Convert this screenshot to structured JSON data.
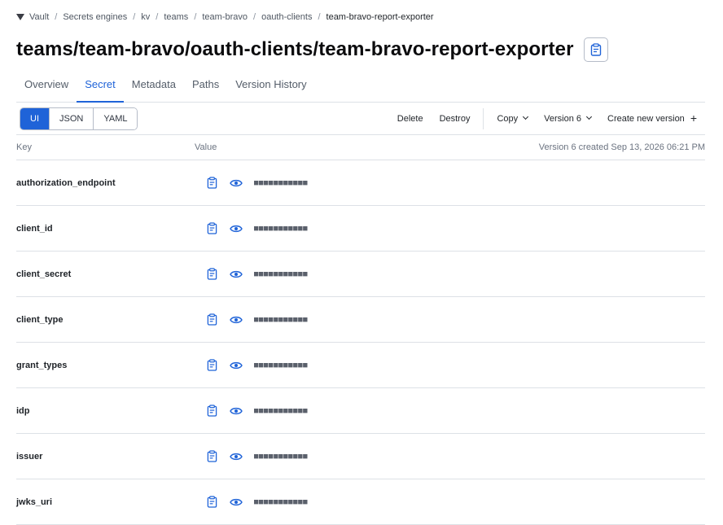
{
  "breadcrumb": {
    "items": [
      "Vault",
      "Secrets engines",
      "kv",
      "teams",
      "team-bravo",
      "oauth-clients"
    ],
    "current": "team-bravo-report-exporter",
    "separator": "/"
  },
  "page": {
    "title": "teams/team-bravo/oauth-clients/team-bravo-report-exporter"
  },
  "tabs": [
    {
      "label": "Overview",
      "active": false
    },
    {
      "label": "Secret",
      "active": true
    },
    {
      "label": "Metadata",
      "active": false
    },
    {
      "label": "Paths",
      "active": false
    },
    {
      "label": "Version History",
      "active": false
    }
  ],
  "toolbar": {
    "view_modes": [
      {
        "label": "UI",
        "active": true
      },
      {
        "label": "JSON",
        "active": false
      },
      {
        "label": "YAML",
        "active": false
      }
    ],
    "delete_label": "Delete",
    "destroy_label": "Destroy",
    "copy_label": "Copy",
    "version_label": "Version 6",
    "create_label": "Create new version",
    "create_icon": "+"
  },
  "columns": {
    "key": "Key",
    "value": "Value",
    "meta": "Version 6 created Sep 13, 2026 06:21 PM"
  },
  "rows": [
    {
      "key": "authorization_endpoint",
      "masked": "■■■■■■■■■■■"
    },
    {
      "key": "client_id",
      "masked": "■■■■■■■■■■■"
    },
    {
      "key": "client_secret",
      "masked": "■■■■■■■■■■■"
    },
    {
      "key": "client_type",
      "masked": "■■■■■■■■■■■"
    },
    {
      "key": "grant_types",
      "masked": "■■■■■■■■■■■"
    },
    {
      "key": "idp",
      "masked": "■■■■■■■■■■■"
    },
    {
      "key": "issuer",
      "masked": "■■■■■■■■■■■"
    },
    {
      "key": "jwks_uri",
      "masked": "■■■■■■■■■■■"
    }
  ],
  "icons": {
    "logo": "vault-logo-icon",
    "copy": "clipboard-icon",
    "reveal": "eye-icon",
    "dropdown": "chevron-down-icon"
  },
  "colors": {
    "accent": "#1f63d8",
    "title": "#0c0c0e",
    "border": "#dde1e6",
    "muted": "#6b7380"
  }
}
